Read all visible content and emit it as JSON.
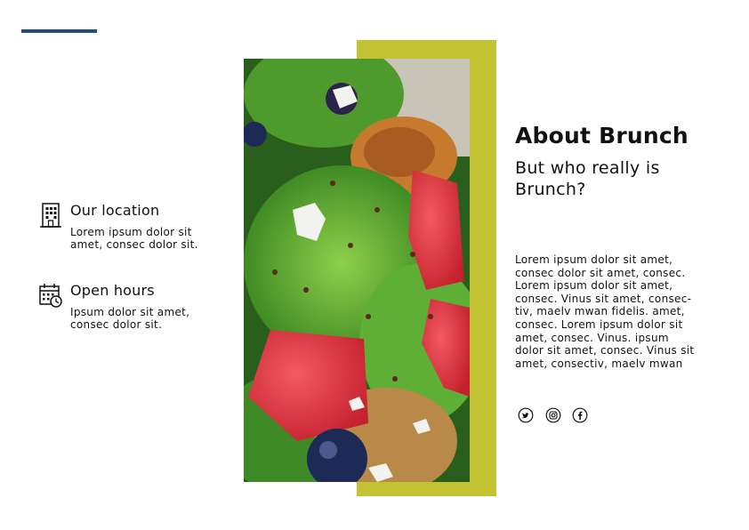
{
  "location": {
    "title": "Our location",
    "line1": "Lorem ipsum dolor sit",
    "line2": "amet, consec  dolor sit.",
    "icon": "building-icon"
  },
  "hours": {
    "title": "Open hours",
    "line1": "Ipsum dolor sit amet,",
    "line2": "consec  dolor sit.",
    "icon": "calendar-clock-icon"
  },
  "about": {
    "title": "About Brunch",
    "subtitle_line1": "But who really is",
    "subtitle_line2": "Brunch?",
    "body_lines": [
      "Lorem ipsum dolor sit amet,",
      "consec  dolor sit amet, consec.",
      "Lorem ipsum dolor sit amet,",
      "consec. Vinus  sit amet, consec-",
      "tiv, maelv mwan fidelis. amet,",
      "consec. Lorem ipsum dolor sit",
      "amet, consec. Vinus.  ipsum",
      "dolor sit amet, consec. Vinus  sit",
      "amet, consectiv, maelv mwan"
    ]
  },
  "social": [
    "twitter-icon",
    "instagram-icon",
    "facebook-icon"
  ],
  "colors": {
    "accent_blue": "#1e4f82",
    "olive": "#c2c232",
    "text": "#111111"
  },
  "photo": {
    "subject": "salad-photo"
  }
}
